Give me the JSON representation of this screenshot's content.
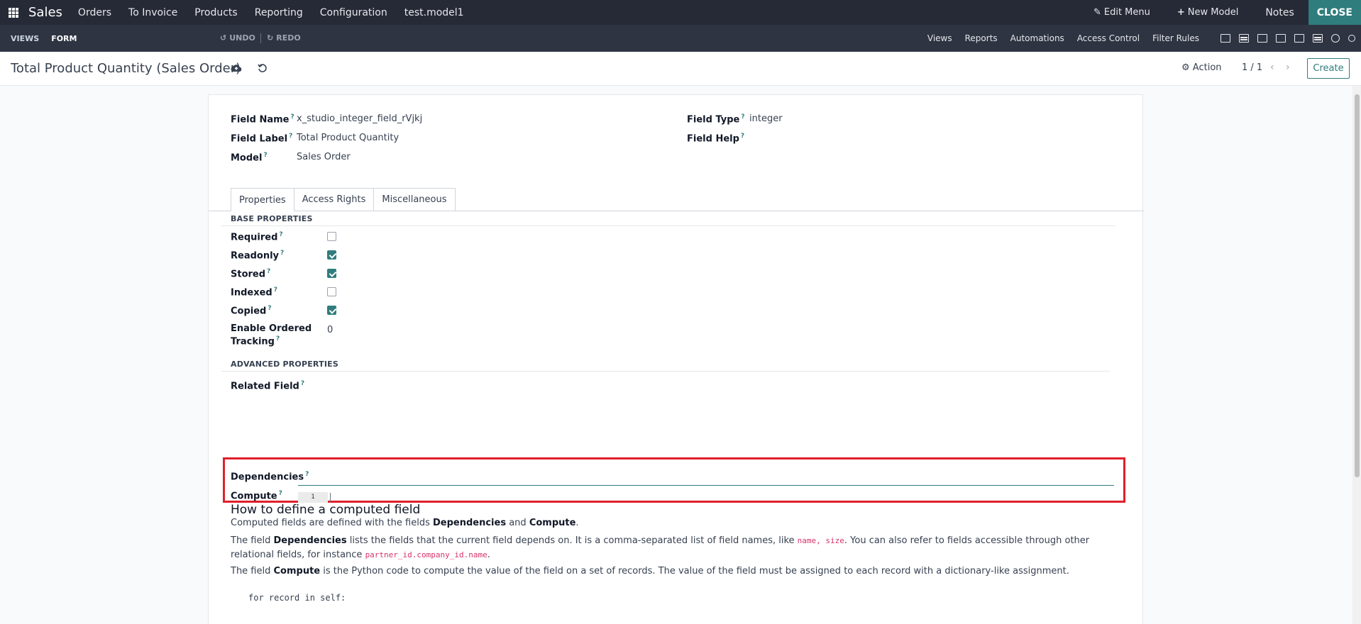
{
  "topbar": {
    "app_name": "Sales",
    "menu": [
      "Orders",
      "To Invoice",
      "Products",
      "Reporting",
      "Configuration",
      "test.model1"
    ],
    "edit_menu": "Edit Menu",
    "new_model": "New Model",
    "notes": "Notes",
    "close": "CLOSE"
  },
  "studiobar": {
    "views": "VIEWS",
    "form": "FORM",
    "undo": "UNDO",
    "redo": "REDO",
    "links": [
      "Views",
      "Reports",
      "Automations",
      "Access Control",
      "Filter Rules"
    ],
    "view_icons": [
      "form-view-icon",
      "list-view-icon",
      "kanban-view-icon",
      "calendar-view-icon",
      "graph-view-icon",
      "pivot-view-icon",
      "activity-view-icon",
      "search-view-icon"
    ]
  },
  "control": {
    "title": "Total Product Quantity (Sales Order)",
    "action": "Action",
    "pager": "1 / 1",
    "create": "Create"
  },
  "fields": {
    "field_name_label": "Field Name",
    "field_name_value": "x_studio_integer_field_rVjkj",
    "field_label_label": "Field Label",
    "field_label_value": "Total Product Quantity",
    "model_label": "Model",
    "model_value": "Sales Order",
    "field_type_label": "Field Type",
    "field_type_value": "integer",
    "field_help_label": "Field Help",
    "help_marker": "?"
  },
  "tabs": [
    "Properties",
    "Access Rights",
    "Miscellaneous"
  ],
  "base_properties": {
    "title": "BASE PROPERTIES",
    "required": "Required",
    "readonly": "Readonly",
    "stored": "Stored",
    "indexed": "Indexed",
    "copied": "Copied",
    "tracking_line1": "Enable Ordered",
    "tracking_line2": "Tracking",
    "tracking_value": "0",
    "checks": {
      "required": false,
      "readonly": true,
      "stored": true,
      "indexed": false,
      "copied": true
    }
  },
  "advanced_properties": {
    "title": "ADVANCED PROPERTIES",
    "related_field": "Related Field",
    "dependencies": "Dependencies",
    "compute": "Compute",
    "line_number": "1"
  },
  "help": {
    "title": "How to define a computed field",
    "p1_a": "Computed fields are defined with the fields ",
    "p1_b": "Dependencies",
    "p1_c": " and ",
    "p1_d": "Compute",
    "p1_e": ".",
    "p2_a": "The field ",
    "p2_b": "Dependencies",
    "p2_c": " lists the fields that the current field depends on. It is a comma-separated list of field names, like ",
    "p2_code1": "name, size",
    "p2_d": ". You can also refer to fields accessible through other relational fields, for instance ",
    "p2_code2": "partner_id.company_id.name",
    "p2_e": ".",
    "p3_a": "The field ",
    "p3_b": "Compute",
    "p3_c": " is the Python code to compute the value of the field on a set of records. The value of the field must be assigned to each record with a dictionary-like assignment.",
    "code_line": "for record in self:"
  },
  "colors": {
    "accent": "#2f7d7c",
    "highlight": "#e0202b",
    "navbar": "#262a36"
  }
}
